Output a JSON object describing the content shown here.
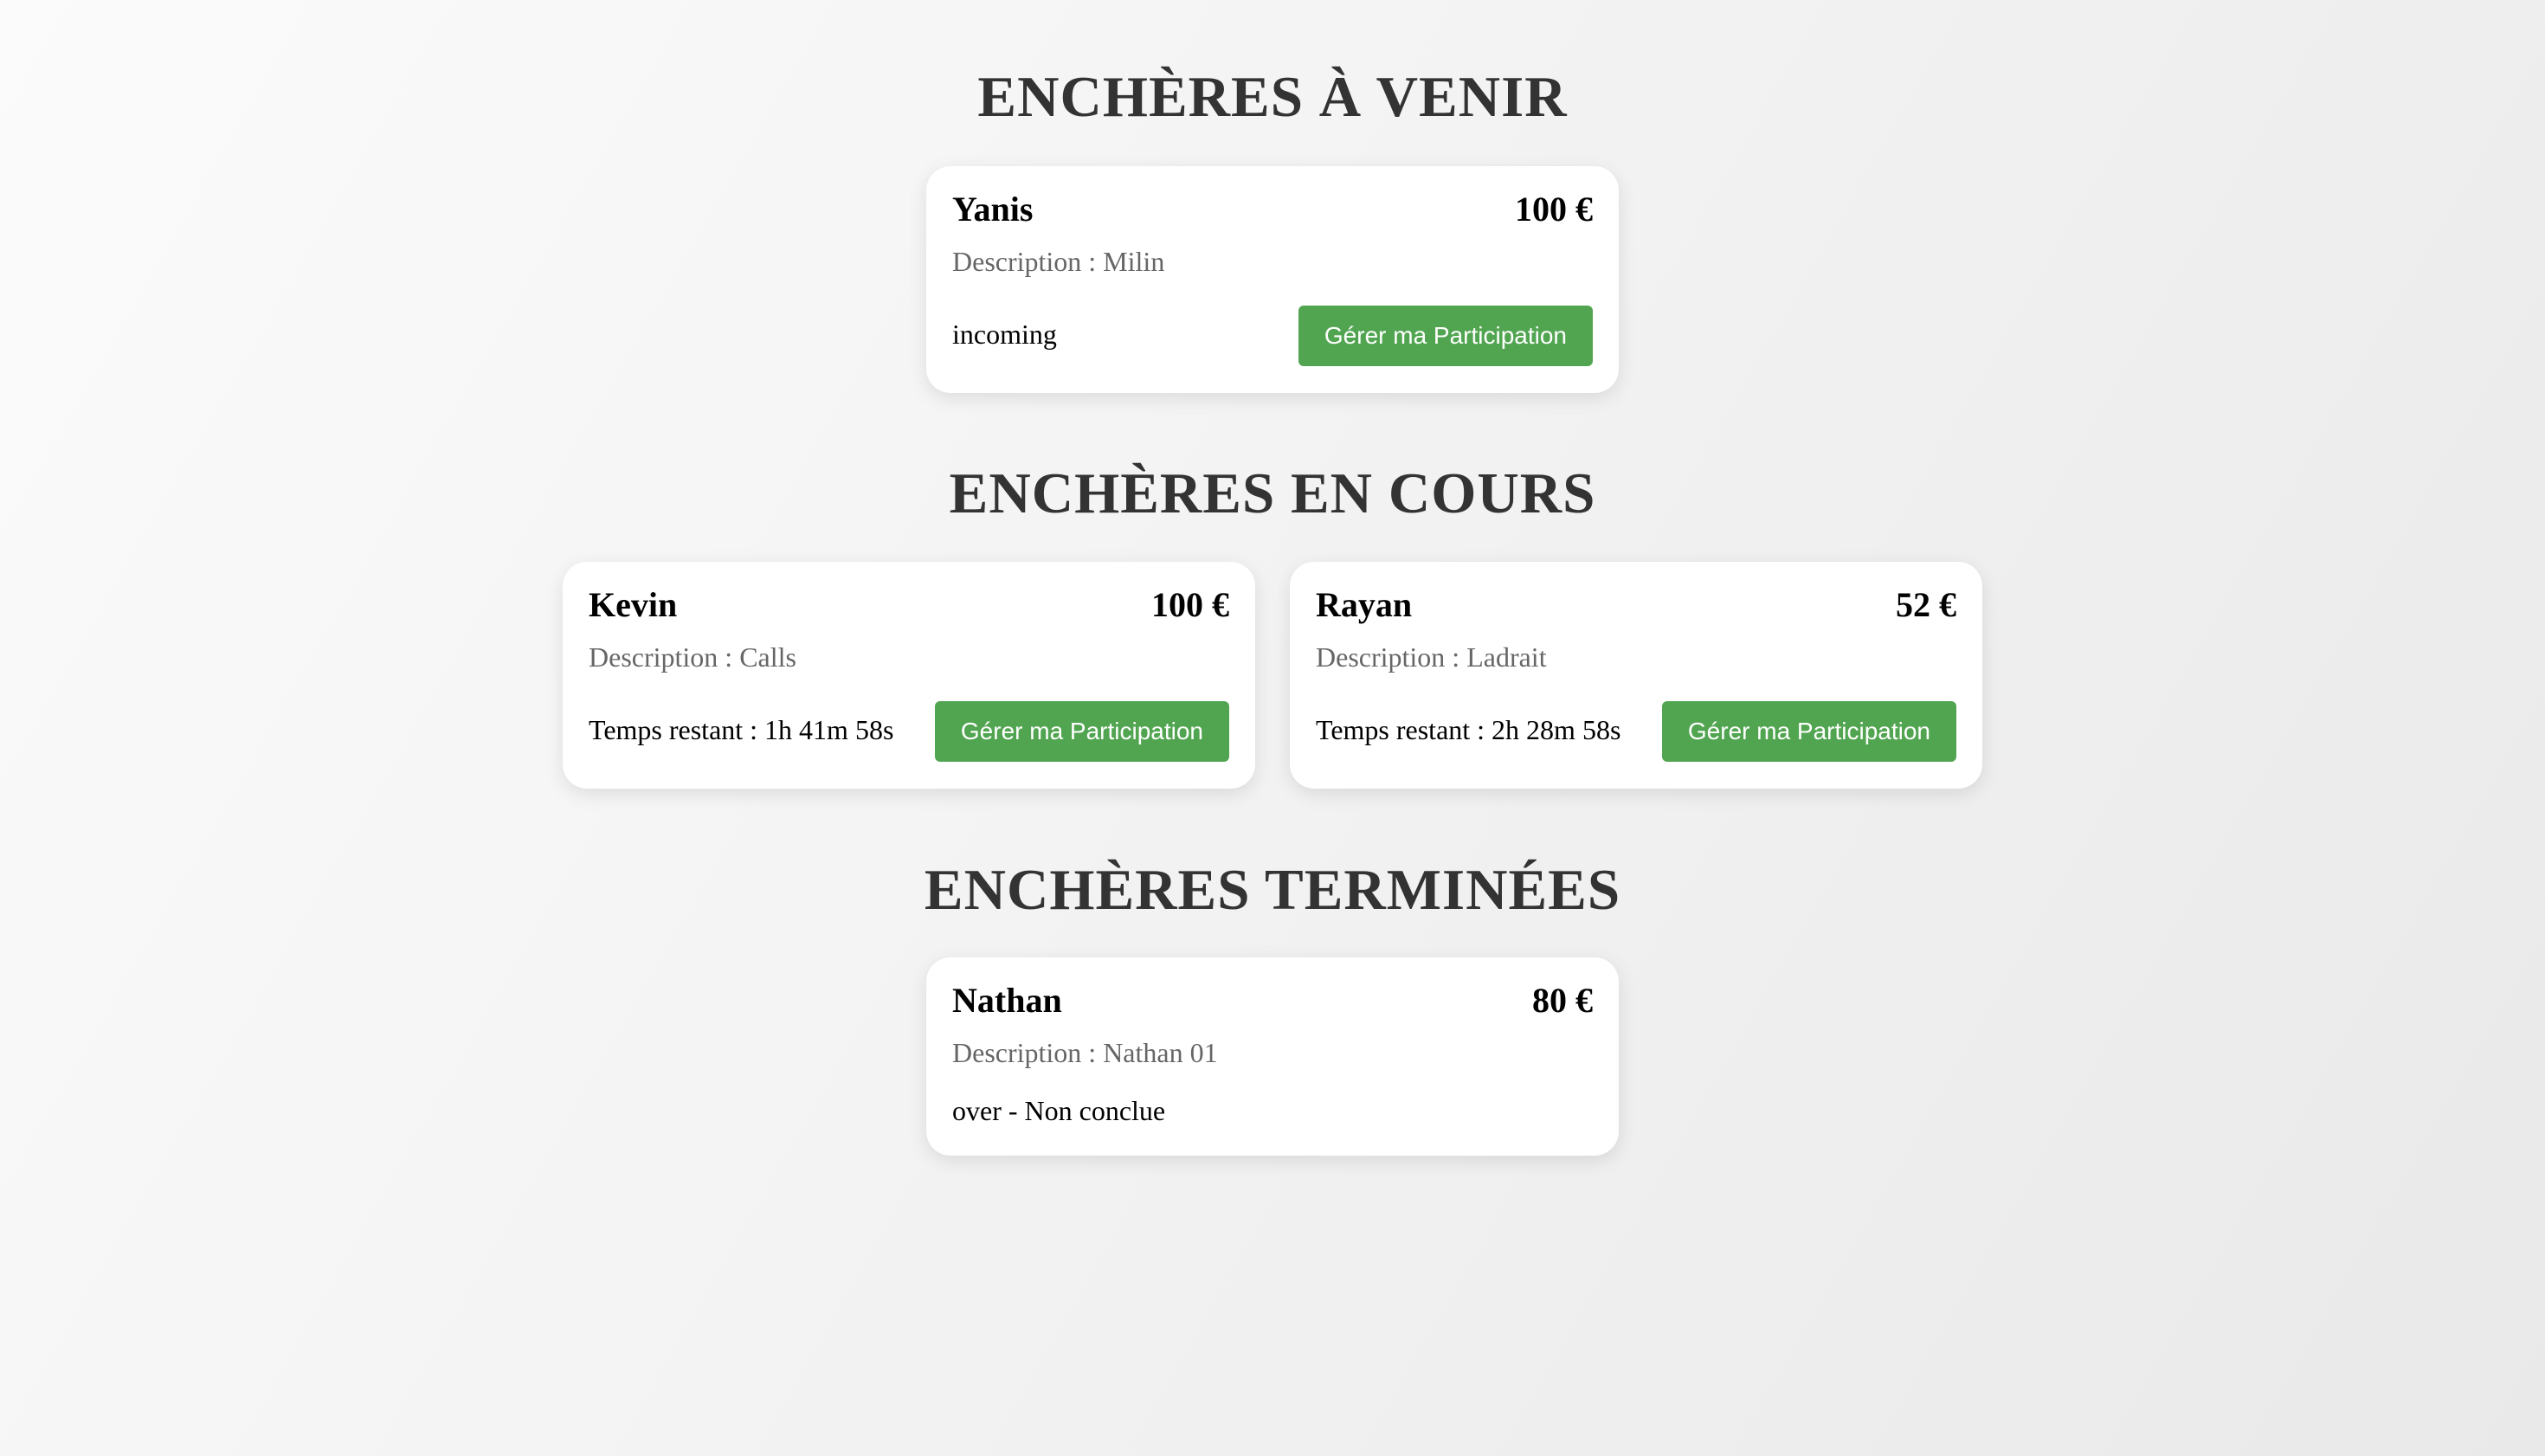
{
  "sections": [
    {
      "title": "ENCHÈRES À VENIR",
      "cards": [
        {
          "name": "Yanis",
          "price": "100 €",
          "description_label": "Description : ",
          "description": "Milin",
          "status": "incoming",
          "button_label": "Gérer ma Participation"
        }
      ]
    },
    {
      "title": "ENCHÈRES EN COURS",
      "cards": [
        {
          "name": "Kevin",
          "price": "100 €",
          "description_label": "Description : ",
          "description": "Calls",
          "status": "Temps restant : 1h 41m 58s",
          "button_label": "Gérer ma Participation"
        },
        {
          "name": "Rayan",
          "price": "52 €",
          "description_label": "Description : ",
          "description": "Ladrait",
          "status": "Temps restant : 2h 28m 58s",
          "button_label": "Gérer ma Participation"
        }
      ]
    },
    {
      "title": "ENCHÈRES TERMINÉES",
      "cards": [
        {
          "name": "Nathan",
          "price": "80 €",
          "description_label": "Description : ",
          "description": "Nathan 01",
          "status": "over - Non conclue"
        }
      ]
    }
  ],
  "colors": {
    "button_bg": "#51a551",
    "title_text": "#333333",
    "description_text": "#666666",
    "card_bg": "#ffffff"
  }
}
